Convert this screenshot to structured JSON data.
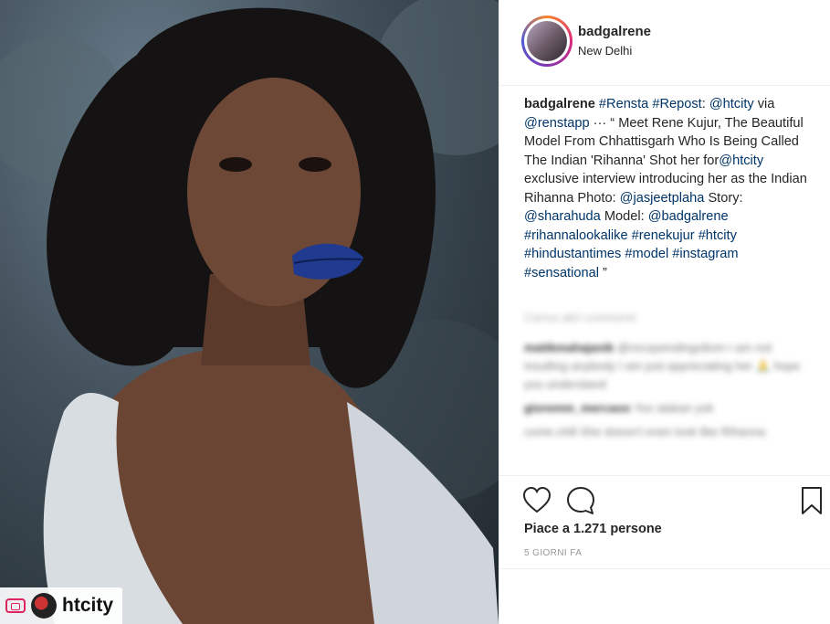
{
  "photo": {
    "alt_icon": "repost-icon",
    "tag_name": "htcity"
  },
  "post": {
    "username": "badgalrene",
    "location": "New Delhi"
  },
  "caption": {
    "username": "badgalrene",
    "segments": [
      {
        "t": " ",
        "tag": false
      },
      {
        "t": "#Rensta",
        "tag": true
      },
      {
        "t": " ",
        "tag": false
      },
      {
        "t": "#Repost",
        "tag": true
      },
      {
        "t": ": ",
        "tag": false
      },
      {
        "t": "@htcity",
        "tag": true
      },
      {
        "t": " via ",
        "tag": false
      },
      {
        "t": "@renstapp",
        "tag": true
      },
      {
        "t": " ··· “ Meet Rene Kujur, The Beautiful Model From Chhattisgarh Who Is Being Called The Indian 'Rihanna' Shot her for",
        "tag": false
      },
      {
        "t": "@htcity",
        "tag": true
      },
      {
        "t": " exclusive interview introducing her as the Indian Rihanna Photo: ",
        "tag": false
      },
      {
        "t": "@jasjeetplaha",
        "tag": true
      },
      {
        "t": " Story: ",
        "tag": false
      },
      {
        "t": "@sharahuda",
        "tag": true
      },
      {
        "t": " Model: ",
        "tag": false
      },
      {
        "t": "@badgalrene",
        "tag": true
      },
      {
        "t": " ",
        "tag": false
      },
      {
        "t": "#rihannalookalike",
        "tag": true
      },
      {
        "t": " ",
        "tag": false
      },
      {
        "t": "#renekujur",
        "tag": true
      },
      {
        "t": " ",
        "tag": false
      },
      {
        "t": "#htcity",
        "tag": true
      },
      {
        "t": " ",
        "tag": false
      },
      {
        "t": "#hindustantimes",
        "tag": true
      },
      {
        "t": " ",
        "tag": false
      },
      {
        "t": "#model",
        "tag": true
      },
      {
        "t": " ",
        "tag": false
      },
      {
        "t": "#instagram",
        "tag": true
      },
      {
        "t": " ",
        "tag": false
      },
      {
        "t": "#sensational",
        "tag": true
      },
      {
        "t": " ”",
        "tag": false
      }
    ]
  },
  "comments": {
    "load_more": "Carica altri commenti",
    "items": [
      {
        "user": "mattkmahajanik",
        "text": "@mcopeindingoltom I am not insulting anybody I am just appreciating her 🙏 hope you understand"
      },
      {
        "user": "gioremm_mercaoo",
        "text": "Yoo alakan yok"
      },
      {
        "user": "",
        "text": "come.chill She doesn't even look like Rihanna"
      }
    ]
  },
  "actions": {
    "like_icon": "heart-icon",
    "comment_icon": "comment-icon",
    "save_icon": "bookmark-icon"
  },
  "likes": "Piace a 1.271 persone",
  "date": "5 GIORNI FA"
}
